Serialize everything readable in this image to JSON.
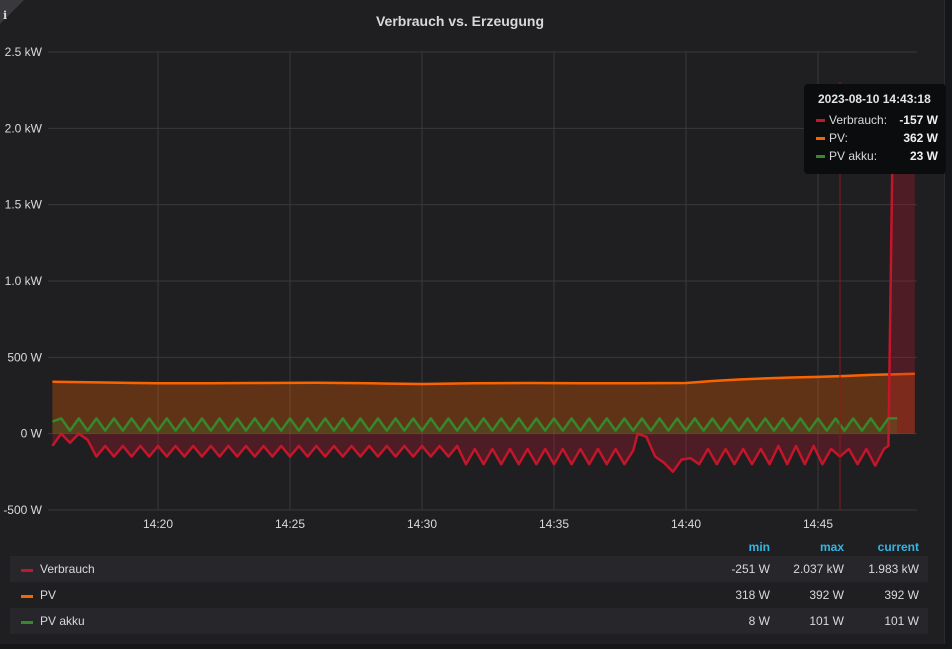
{
  "panel": {
    "title": "Verbrauch vs. Erzeugung",
    "info_icon": "i"
  },
  "colors": {
    "verbrauch": "#c4162a",
    "pv": "#fa6400",
    "pv_akku": "#37872d",
    "grid": "#38383d",
    "text": "#d8d9da"
  },
  "tooltip": {
    "time": "2023-08-10 14:43:18",
    "rows": [
      {
        "name": "Verbrauch:",
        "value": "-157 W"
      },
      {
        "name": "PV:",
        "value": "362 W"
      },
      {
        "name": "PV akku:",
        "value": "23 W"
      }
    ]
  },
  "legend": {
    "headers": {
      "min": "min",
      "max": "max",
      "current": "current"
    },
    "rows": [
      {
        "name": "Verbrauch",
        "min": "-251 W",
        "max": "2.037 kW",
        "current": "1.983 kW"
      },
      {
        "name": "PV",
        "min": "318 W",
        "max": "392 W",
        "current": "392 W"
      },
      {
        "name": "PV akku",
        "min": "8 W",
        "max": "101 W",
        "current": "101 W"
      }
    ]
  },
  "chart_data": {
    "type": "area",
    "title": "Verbrauch vs. Erzeugung",
    "x_unit": "time",
    "xlim": [
      "14:15:50",
      "14:48:45"
    ],
    "ylim": [
      -500,
      2500
    ],
    "y_ticks": [
      -500,
      0,
      500,
      1000,
      1500,
      2000,
      2500
    ],
    "y_tick_labels": [
      "-500 W",
      "0 W",
      "500 W",
      "1.0 kW",
      "1.5 kW",
      "2.0 kW",
      "2.5 kW"
    ],
    "x_ticks": [
      "14:20",
      "14:25",
      "14:30",
      "14:35",
      "14:40",
      "14:45"
    ],
    "grid": true,
    "crosshair_time": "14:45:50",
    "series": [
      {
        "name": "Verbrauch",
        "points": [
          [
            "14:16:00",
            -80
          ],
          [
            "14:16:20",
            0
          ],
          [
            "14:16:40",
            -60
          ],
          [
            "14:17:00",
            0
          ],
          [
            "14:17:20",
            -40
          ],
          [
            "14:17:40",
            -150
          ],
          [
            "14:18:00",
            -80
          ],
          [
            "14:18:20",
            -150
          ],
          [
            "14:18:40",
            -80
          ],
          [
            "14:19:00",
            -150
          ],
          [
            "14:19:20",
            -80
          ],
          [
            "14:19:40",
            -150
          ],
          [
            "14:20:00",
            -80
          ],
          [
            "14:20:20",
            -150
          ],
          [
            "14:20:40",
            -80
          ],
          [
            "14:21:00",
            -150
          ],
          [
            "14:21:20",
            -80
          ],
          [
            "14:21:40",
            -150
          ],
          [
            "14:22:00",
            -80
          ],
          [
            "14:22:20",
            -150
          ],
          [
            "14:22:40",
            -80
          ],
          [
            "14:23:00",
            -150
          ],
          [
            "14:23:20",
            -80
          ],
          [
            "14:23:40",
            -150
          ],
          [
            "14:24:00",
            -80
          ],
          [
            "14:24:20",
            -150
          ],
          [
            "14:24:40",
            -80
          ],
          [
            "14:25:00",
            -150
          ],
          [
            "14:25:20",
            -80
          ],
          [
            "14:25:40",
            -150
          ],
          [
            "14:26:00",
            -80
          ],
          [
            "14:26:20",
            -150
          ],
          [
            "14:26:40",
            -80
          ],
          [
            "14:27:00",
            -150
          ],
          [
            "14:27:20",
            -80
          ],
          [
            "14:27:40",
            -150
          ],
          [
            "14:28:00",
            -80
          ],
          [
            "14:28:20",
            -150
          ],
          [
            "14:28:40",
            -80
          ],
          [
            "14:29:00",
            -150
          ],
          [
            "14:29:20",
            -80
          ],
          [
            "14:29:40",
            -150
          ],
          [
            "14:30:00",
            -80
          ],
          [
            "14:30:20",
            -150
          ],
          [
            "14:30:40",
            -80
          ],
          [
            "14:31:00",
            -150
          ],
          [
            "14:31:20",
            -80
          ],
          [
            "14:31:40",
            -200
          ],
          [
            "14:32:00",
            -100
          ],
          [
            "14:32:20",
            -200
          ],
          [
            "14:32:40",
            -100
          ],
          [
            "14:33:00",
            -200
          ],
          [
            "14:33:20",
            -100
          ],
          [
            "14:33:40",
            -200
          ],
          [
            "14:34:00",
            -100
          ],
          [
            "14:34:20",
            -200
          ],
          [
            "14:34:40",
            -100
          ],
          [
            "14:35:00",
            -200
          ],
          [
            "14:35:20",
            -100
          ],
          [
            "14:35:40",
            -200
          ],
          [
            "14:36:00",
            -100
          ],
          [
            "14:36:20",
            -200
          ],
          [
            "14:36:40",
            -100
          ],
          [
            "14:37:00",
            -200
          ],
          [
            "14:37:20",
            -100
          ],
          [
            "14:37:40",
            -200
          ],
          [
            "14:38:00",
            -110
          ],
          [
            "14:38:10",
            0
          ],
          [
            "14:38:30",
            -20
          ],
          [
            "14:38:50",
            -150
          ],
          [
            "14:39:10",
            -190
          ],
          [
            "14:39:30",
            -250
          ],
          [
            "14:39:50",
            -170
          ],
          [
            "14:40:10",
            -160
          ],
          [
            "14:40:30",
            -200
          ],
          [
            "14:40:50",
            -100
          ],
          [
            "14:41:10",
            -200
          ],
          [
            "14:41:30",
            -100
          ],
          [
            "14:41:50",
            -200
          ],
          [
            "14:42:10",
            -100
          ],
          [
            "14:42:30",
            -200
          ],
          [
            "14:42:50",
            -100
          ],
          [
            "14:43:10",
            -200
          ],
          [
            "14:43:30",
            -80
          ],
          [
            "14:43:50",
            -200
          ],
          [
            "14:44:10",
            -80
          ],
          [
            "14:44:30",
            -200
          ],
          [
            "14:44:50",
            -80
          ],
          [
            "14:45:10",
            -200
          ],
          [
            "14:45:30",
            -100
          ],
          [
            "14:45:50",
            -150
          ],
          [
            "14:46:10",
            -100
          ],
          [
            "14:46:30",
            -200
          ],
          [
            "14:46:50",
            -100
          ],
          [
            "14:47:10",
            -210
          ],
          [
            "14:47:30",
            -100
          ],
          [
            "14:47:40",
            -80
          ],
          [
            "14:47:50",
            1983
          ],
          [
            "14:48:00",
            2037
          ],
          [
            "14:48:40",
            1983
          ]
        ]
      },
      {
        "name": "PV",
        "points": [
          [
            "14:16:00",
            340
          ],
          [
            "14:18:00",
            335
          ],
          [
            "14:20:00",
            330
          ],
          [
            "14:22:00",
            330
          ],
          [
            "14:24:00",
            332
          ],
          [
            "14:26:00",
            333
          ],
          [
            "14:28:00",
            330
          ],
          [
            "14:30:00",
            325
          ],
          [
            "14:32:00",
            330
          ],
          [
            "14:34:00",
            332
          ],
          [
            "14:36:00",
            330
          ],
          [
            "14:38:00",
            330
          ],
          [
            "14:40:00",
            332
          ],
          [
            "14:41:00",
            345
          ],
          [
            "14:42:00",
            355
          ],
          [
            "14:43:00",
            362
          ],
          [
            "14:44:00",
            368
          ],
          [
            "14:45:00",
            372
          ],
          [
            "14:46:00",
            378
          ],
          [
            "14:47:00",
            385
          ],
          [
            "14:48:40",
            392
          ]
        ]
      },
      {
        "name": "PV akku",
        "points": [
          [
            "14:16:00",
            80
          ],
          [
            "14:16:20",
            100
          ],
          [
            "14:16:40",
            20
          ],
          [
            "14:17:00",
            100
          ],
          [
            "14:17:20",
            20
          ],
          [
            "14:17:40",
            100
          ],
          [
            "14:18:00",
            20
          ],
          [
            "14:18:20",
            100
          ],
          [
            "14:18:40",
            20
          ],
          [
            "14:19:00",
            100
          ],
          [
            "14:19:20",
            20
          ],
          [
            "14:19:40",
            100
          ],
          [
            "14:20:00",
            20
          ],
          [
            "14:20:20",
            100
          ],
          [
            "14:20:40",
            20
          ],
          [
            "14:21:00",
            100
          ],
          [
            "14:21:20",
            20
          ],
          [
            "14:21:40",
            100
          ],
          [
            "14:22:00",
            20
          ],
          [
            "14:22:20",
            100
          ],
          [
            "14:22:40",
            20
          ],
          [
            "14:23:00",
            100
          ],
          [
            "14:23:20",
            20
          ],
          [
            "14:23:40",
            100
          ],
          [
            "14:24:00",
            20
          ],
          [
            "14:24:20",
            100
          ],
          [
            "14:24:40",
            20
          ],
          [
            "14:25:00",
            100
          ],
          [
            "14:25:20",
            20
          ],
          [
            "14:25:40",
            100
          ],
          [
            "14:26:00",
            20
          ],
          [
            "14:26:20",
            100
          ],
          [
            "14:26:40",
            20
          ],
          [
            "14:27:00",
            100
          ],
          [
            "14:27:20",
            20
          ],
          [
            "14:27:40",
            100
          ],
          [
            "14:28:00",
            20
          ],
          [
            "14:28:20",
            100
          ],
          [
            "14:28:40",
            20
          ],
          [
            "14:29:00",
            100
          ],
          [
            "14:29:20",
            20
          ],
          [
            "14:29:40",
            100
          ],
          [
            "14:30:00",
            20
          ],
          [
            "14:30:20",
            100
          ],
          [
            "14:30:40",
            20
          ],
          [
            "14:31:00",
            100
          ],
          [
            "14:31:20",
            20
          ],
          [
            "14:31:40",
            100
          ],
          [
            "14:32:00",
            20
          ],
          [
            "14:32:20",
            100
          ],
          [
            "14:32:40",
            20
          ],
          [
            "14:33:00",
            100
          ],
          [
            "14:33:20",
            20
          ],
          [
            "14:33:40",
            100
          ],
          [
            "14:34:00",
            20
          ],
          [
            "14:34:20",
            100
          ],
          [
            "14:34:40",
            20
          ],
          [
            "14:35:00",
            100
          ],
          [
            "14:35:20",
            20
          ],
          [
            "14:35:40",
            100
          ],
          [
            "14:36:00",
            20
          ],
          [
            "14:36:20",
            100
          ],
          [
            "14:36:40",
            20
          ],
          [
            "14:37:00",
            100
          ],
          [
            "14:37:20",
            20
          ],
          [
            "14:37:40",
            100
          ],
          [
            "14:38:00",
            20
          ],
          [
            "14:38:20",
            100
          ],
          [
            "14:38:40",
            20
          ],
          [
            "14:39:00",
            100
          ],
          [
            "14:39:20",
            20
          ],
          [
            "14:39:40",
            100
          ],
          [
            "14:40:00",
            20
          ],
          [
            "14:40:20",
            100
          ],
          [
            "14:40:40",
            20
          ],
          [
            "14:41:00",
            100
          ],
          [
            "14:41:20",
            20
          ],
          [
            "14:41:40",
            100
          ],
          [
            "14:42:00",
            20
          ],
          [
            "14:42:20",
            100
          ],
          [
            "14:42:40",
            20
          ],
          [
            "14:43:00",
            100
          ],
          [
            "14:43:20",
            20
          ],
          [
            "14:43:40",
            100
          ],
          [
            "14:44:00",
            20
          ],
          [
            "14:44:20",
            100
          ],
          [
            "14:44:40",
            20
          ],
          [
            "14:45:00",
            100
          ],
          [
            "14:45:20",
            20
          ],
          [
            "14:45:40",
            100
          ],
          [
            "14:46:00",
            20
          ],
          [
            "14:46:20",
            100
          ],
          [
            "14:46:40",
            20
          ],
          [
            "14:47:00",
            100
          ],
          [
            "14:47:20",
            20
          ],
          [
            "14:47:40",
            100
          ],
          [
            "14:48:00",
            101
          ]
        ]
      }
    ]
  }
}
